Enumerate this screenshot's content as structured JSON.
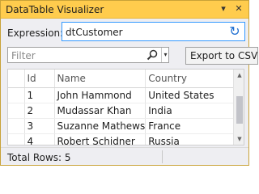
{
  "window": {
    "title": "DataTable Visualizer",
    "dropdown_glyph": "▾",
    "close_glyph": "✕"
  },
  "expression": {
    "label": "Expression:",
    "value": "dtCustomer",
    "refresh_icon": "refresh-icon"
  },
  "filter": {
    "placeholder": "Filter",
    "search_icon": "search-icon",
    "dropdown_glyph": "▾"
  },
  "export": {
    "label": "Export to CSV"
  },
  "grid": {
    "columns": [
      "",
      "Id",
      "Name",
      "Country"
    ],
    "rows": [
      {
        "id": "1",
        "name": "John Hammond",
        "country": "United States"
      },
      {
        "id": "2",
        "name": "Mudassar Khan",
        "country": "India"
      },
      {
        "id": "3",
        "name": "Suzanne Mathews",
        "country": "France"
      },
      {
        "id": "4",
        "name": "Robert Schidner",
        "country": "Russia"
      }
    ]
  },
  "status": {
    "total_rows": "Total Rows: 5"
  },
  "colors": {
    "title_bar": "#ffcc4d",
    "focus_border": "#3399ff"
  }
}
